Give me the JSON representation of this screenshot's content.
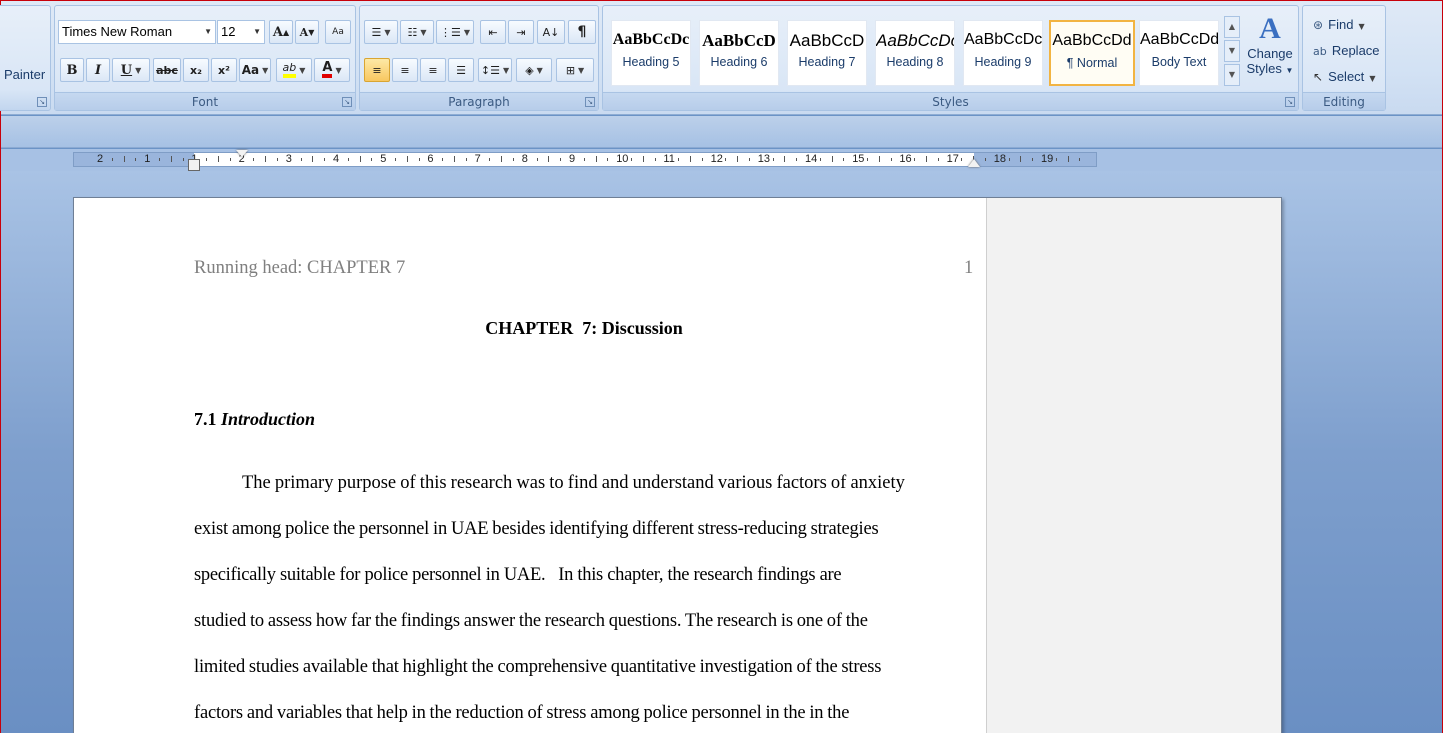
{
  "ribbon": {
    "clipboard": {
      "format_painter_label": "Painter"
    },
    "font": {
      "font_name": "Times New Roman",
      "font_size": "12",
      "grow_label": "A",
      "shrink_label": "A",
      "clear_label": "Aa",
      "bold": "B",
      "italic": "I",
      "underline": "U",
      "strike": "abc",
      "subscript": "x₂",
      "superscript": "x²",
      "change_case": "Aa",
      "highlight": "ab",
      "font_color": "A",
      "group_label": "Font"
    },
    "paragraph": {
      "group_label": "Paragraph"
    },
    "styles": {
      "items": [
        {
          "sample": "AaBbCcDc",
          "name": "Heading 5"
        },
        {
          "sample": "AaBbCcD",
          "name": "Heading 6"
        },
        {
          "sample": "AaBbCcD",
          "name": "Heading 7"
        },
        {
          "sample": "AaBbCcDc",
          "name": "Heading 8"
        },
        {
          "sample": "AaBbCcDc",
          "name": "Heading 9"
        },
        {
          "sample": "AaBbCcDd",
          "name": "¶ Normal"
        },
        {
          "sample": "AaBbCcDd",
          "name": "Body Text"
        }
      ],
      "change_styles_line1": "Change",
      "change_styles_line2": "Styles",
      "group_label": "Styles"
    },
    "editing": {
      "find": "Find",
      "replace": "Replace",
      "select": "Select",
      "group_label": "Editing"
    }
  },
  "ruler": {
    "labels": [
      "2",
      "1",
      "1",
      "2",
      "3",
      "4",
      "5",
      "6",
      "7",
      "8",
      "9",
      "10",
      "11",
      "12",
      "13",
      "14",
      "15",
      "16",
      "17",
      "18",
      "19"
    ]
  },
  "document": {
    "running_head": "Running head: CHAPTER 7",
    "page_number": "1",
    "chapter_title": "CHAPTER  7: Discussion",
    "section_number": "7.1 ",
    "section_title": "Introduction",
    "lines": [
      "The primary purpose of this research was to find and understand various factors of anxiety",
      "exist among police the personnel in UAE besides identifying different stress-reducing strategies",
      "specifically suitable for police personnel in UAE.   In this chapter, the research findings are",
      "studied to assess how far the findings answer the research questions. The research is one of the",
      "limited studies available that highlight the comprehensive quantitative investigation of the stress",
      "factors and variables that help in the reduction of stress among police personnel in the in the"
    ]
  }
}
